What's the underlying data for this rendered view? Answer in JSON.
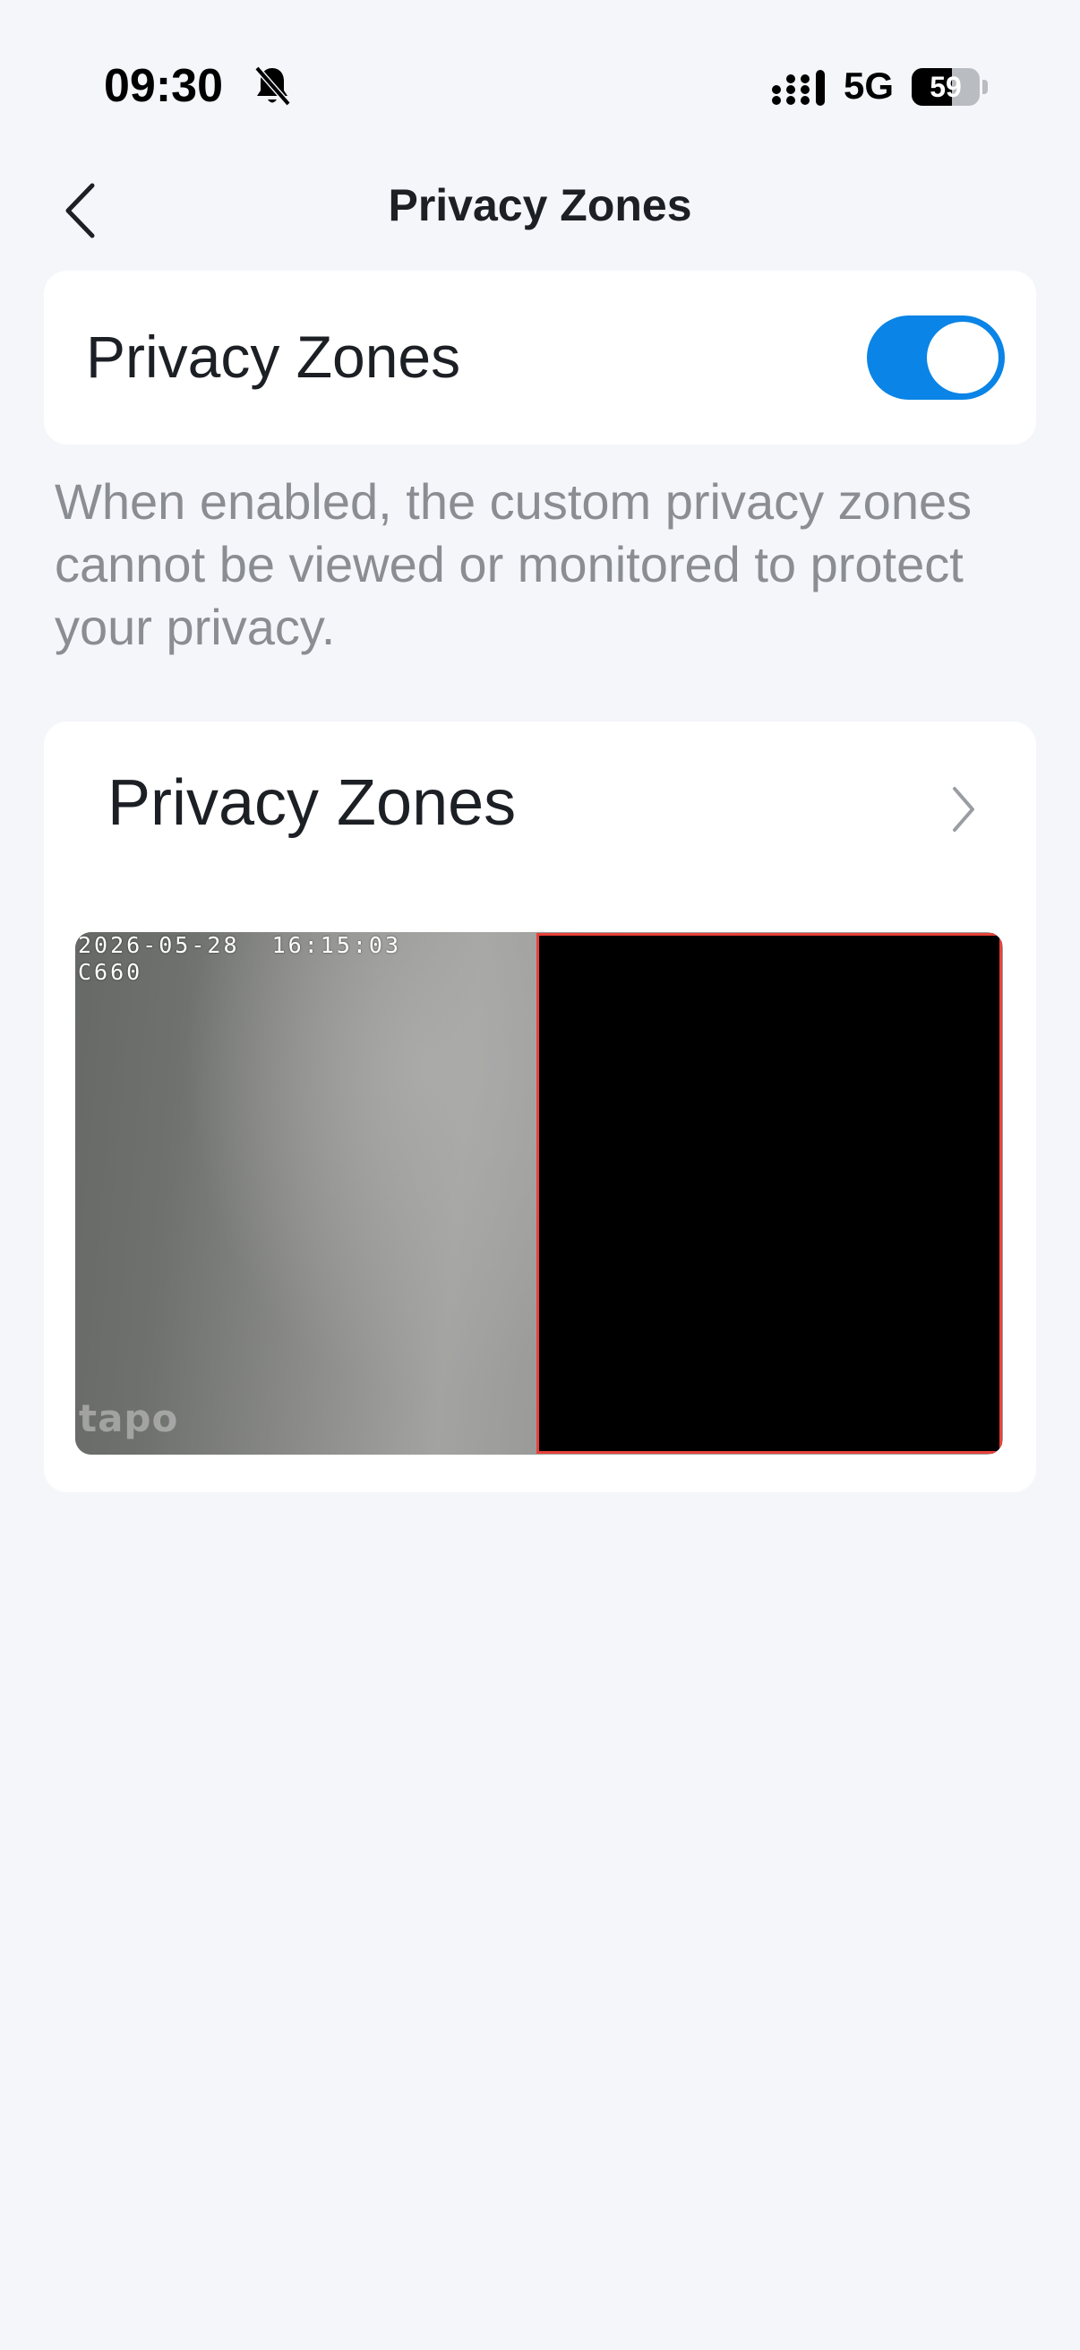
{
  "status_bar": {
    "time": "09:30",
    "network": "5G",
    "battery_level": "59",
    "battery_fraction": 0.59,
    "icons": [
      "bell-slash-icon",
      "signal-icon",
      "battery-icon"
    ]
  },
  "nav": {
    "title": "Privacy Zones",
    "back_icon": "chevron-left-icon"
  },
  "toggle_card": {
    "label": "Privacy Zones",
    "enabled": true,
    "accent_color": "#0a84e6"
  },
  "description": "When enabled, the custom privacy zones cannot be viewed or monitored to protect your privacy.",
  "zones_card": {
    "title": "Privacy Zones",
    "chevron_icon": "chevron-right-icon",
    "preview": {
      "timestamp": "2026-05-28  16:15:03",
      "camera_model": "C660",
      "watermark": "tapo",
      "zone_border_color": "#e8413a"
    }
  }
}
